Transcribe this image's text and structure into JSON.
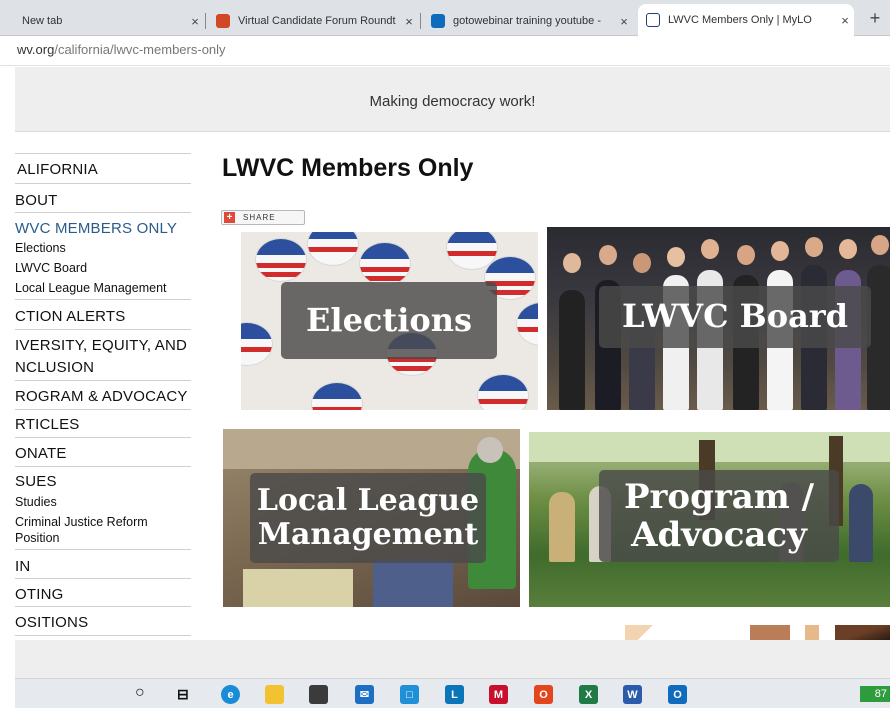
{
  "browser": {
    "tabs": [
      {
        "title": "New tab",
        "favicon": "blank-icon"
      },
      {
        "title": "Virtual Candidate Forum Roundt",
        "favicon": "powerpoint-icon"
      },
      {
        "title": "gotowebinar training youtube - ",
        "favicon": "bing-icon"
      },
      {
        "title": "LWVC Members Only | MyLO",
        "favicon": "lwv-icon"
      }
    ],
    "new_tab_label": "+",
    "close_label": "×",
    "url_domain": "wv.org",
    "url_path": "/california/lwvc-members-only"
  },
  "banner": {
    "tagline": "Making democracy work!"
  },
  "sidebar": {
    "items": [
      {
        "label": "ALIFORNIA"
      },
      {
        "label": "BOUT"
      },
      {
        "label": "WVC MEMBERS ONLY"
      },
      {
        "label": "Elections"
      },
      {
        "label": "LWVC Board"
      },
      {
        "label": "Local League Management"
      },
      {
        "label": "CTION ALERTS"
      },
      {
        "label": "IVERSITY, EQUITY, AND"
      },
      {
        "label": "NCLUSION"
      },
      {
        "label": "ROGRAM & ADVOCACY"
      },
      {
        "label": "RTICLES"
      },
      {
        "label": "ONATE"
      },
      {
        "label": "SUES"
      },
      {
        "label": "Studies"
      },
      {
        "label": "Criminal Justice Reform"
      },
      {
        "label": "Position"
      },
      {
        "label": "IN"
      },
      {
        "label": "OTING"
      },
      {
        "label": "OSITIONS"
      }
    ]
  },
  "main": {
    "title": "LWVC Members Only",
    "share_label": "SHARE",
    "tiles": [
      {
        "label": "Elections"
      },
      {
        "label": "LWVC Board"
      },
      {
        "label": "Local League Management"
      },
      {
        "label": "Program / Advocacy"
      }
    ]
  },
  "taskbar": {
    "icons": [
      "search-icon",
      "task-view-icon",
      "edge-icon",
      "file-explorer-icon",
      "store-icon",
      "mail-icon",
      "outlook-calendar-icon",
      "lync-icon",
      "mcafee-icon",
      "office-icon",
      "excel-icon",
      "word-icon",
      "outlook-icon"
    ],
    "battery": "87"
  },
  "colors": {
    "active_link": "#2a5c8a",
    "banner_bg": "#eeeeee",
    "tile_label_bg": "#4b4b4b"
  }
}
